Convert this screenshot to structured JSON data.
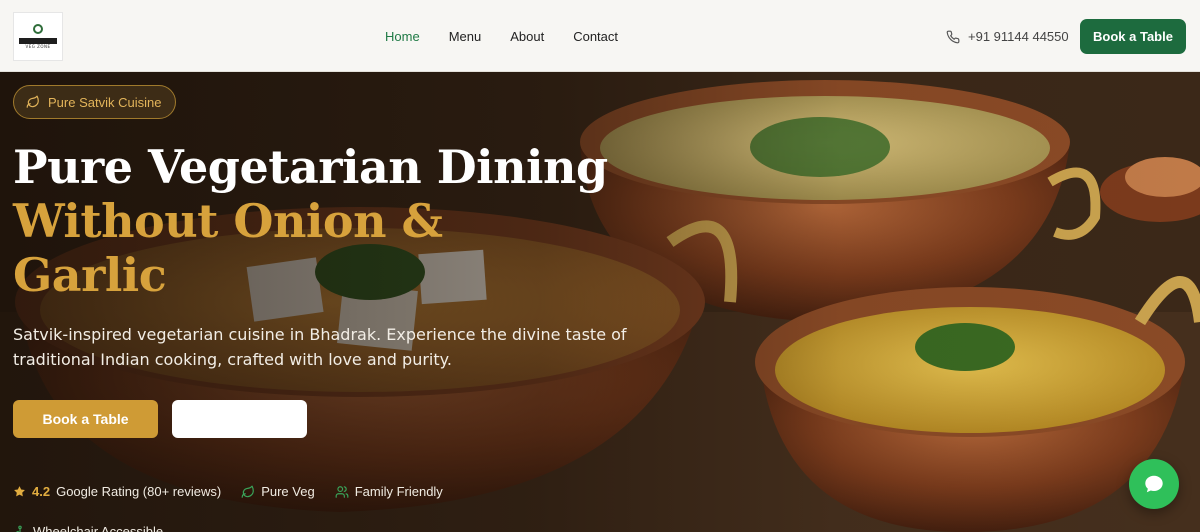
{
  "brand": {
    "logo_text": "VEG ZONE"
  },
  "nav": {
    "items": [
      "Home",
      "Menu",
      "About",
      "Contact"
    ],
    "active": "Home",
    "phone": "+91 91144 44550",
    "cta": "Book a Table"
  },
  "hero": {
    "badge": "Pure Satvik Cuisine",
    "title_line1": "Pure Vegetarian Dining",
    "title_line2": "Without Onion &",
    "title_line3": "Garlic",
    "subtitle": "Satvik-inspired vegetarian cuisine in Bhadrak. Experience the divine taste of traditional Indian cooking, crafted with love and purity.",
    "primary_button": "Book a Table",
    "secondary_button": "",
    "rating_value": "4.2",
    "rating_text": "Google Rating (80+ reviews)",
    "features": [
      "Pure Veg",
      "Family Friendly"
    ],
    "features_row2": [
      "Wheelchair Accessible"
    ]
  },
  "colors": {
    "nav_bg": "#f7f6f3",
    "brand_green": "#1d6b3e",
    "gold": "#d7a23c",
    "chat_green": "#2fc05a"
  },
  "icons": [
    "phone-icon",
    "leaf-icon",
    "star-icon",
    "family-icon",
    "wheelchair-icon",
    "chat-icon"
  ]
}
